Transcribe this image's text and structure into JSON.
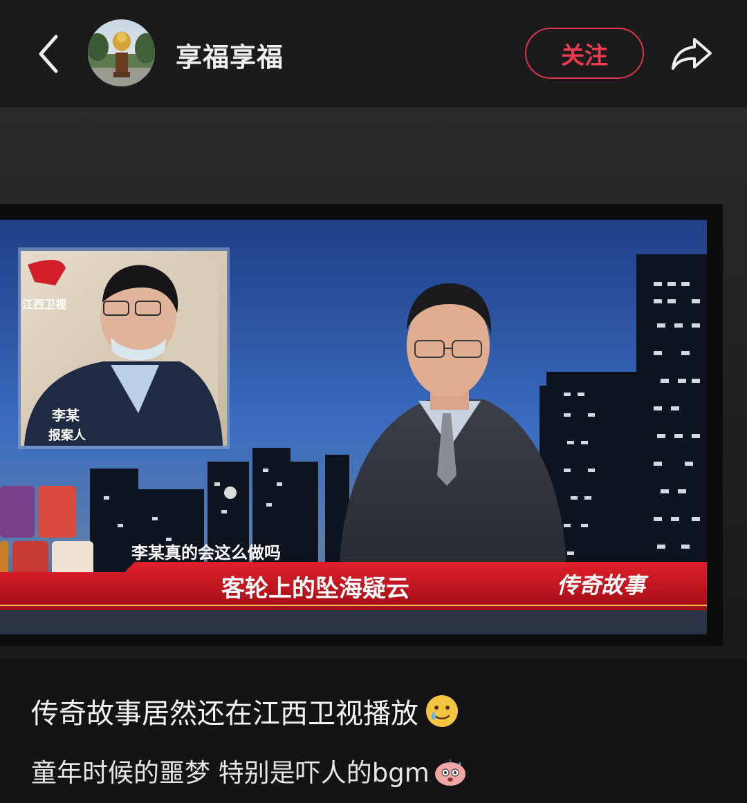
{
  "header": {
    "username": "享福享福",
    "follow_label": "关注"
  },
  "tv": {
    "channel_logo_text": "江西卫视",
    "inset_name": "李某",
    "inset_role": "报案人",
    "subtitle": "李某真的会这么做吗",
    "banner_title": "客轮上的坠海疑云",
    "program_name": "传奇故事"
  },
  "post": {
    "title": "传奇故事居然还在江西卫视播放",
    "subtitle": "童年时候的噩梦 特别是吓人的bgm"
  },
  "colors": {
    "accent": "#e0344a",
    "banner_red": "#c8141e",
    "background": "#141315"
  }
}
